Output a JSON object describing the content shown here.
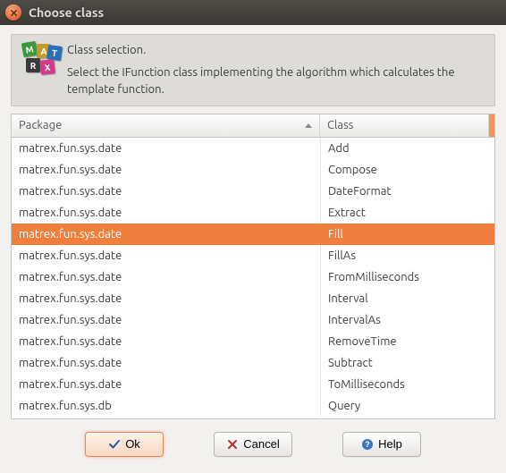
{
  "window": {
    "title": "Choose class"
  },
  "info": {
    "title": "Class selection.",
    "body": "Select the IFunction class implementing the algorithm which calculates the template function."
  },
  "table": {
    "headers": {
      "package": "Package",
      "class": "Class"
    },
    "sort": {
      "column": "package",
      "direction": "asc"
    },
    "selectedIndex": 4,
    "rows": [
      {
        "package": "matrex.fun.sys.date",
        "class": "Add"
      },
      {
        "package": "matrex.fun.sys.date",
        "class": "Compose"
      },
      {
        "package": "matrex.fun.sys.date",
        "class": "DateFormat"
      },
      {
        "package": "matrex.fun.sys.date",
        "class": "Extract"
      },
      {
        "package": "matrex.fun.sys.date",
        "class": "Fill"
      },
      {
        "package": "matrex.fun.sys.date",
        "class": "FillAs"
      },
      {
        "package": "matrex.fun.sys.date",
        "class": "FromMilliseconds"
      },
      {
        "package": "matrex.fun.sys.date",
        "class": "Interval"
      },
      {
        "package": "matrex.fun.sys.date",
        "class": "IntervalAs"
      },
      {
        "package": "matrex.fun.sys.date",
        "class": "RemoveTime"
      },
      {
        "package": "matrex.fun.sys.date",
        "class": "Subtract"
      },
      {
        "package": "matrex.fun.sys.date",
        "class": "ToMilliseconds"
      },
      {
        "package": "matrex.fun.sys.db",
        "class": "Query"
      }
    ]
  },
  "buttons": {
    "ok": "Ok",
    "cancel": "Cancel",
    "help": "Help"
  },
  "colors": {
    "accent": "#f07f3e"
  }
}
